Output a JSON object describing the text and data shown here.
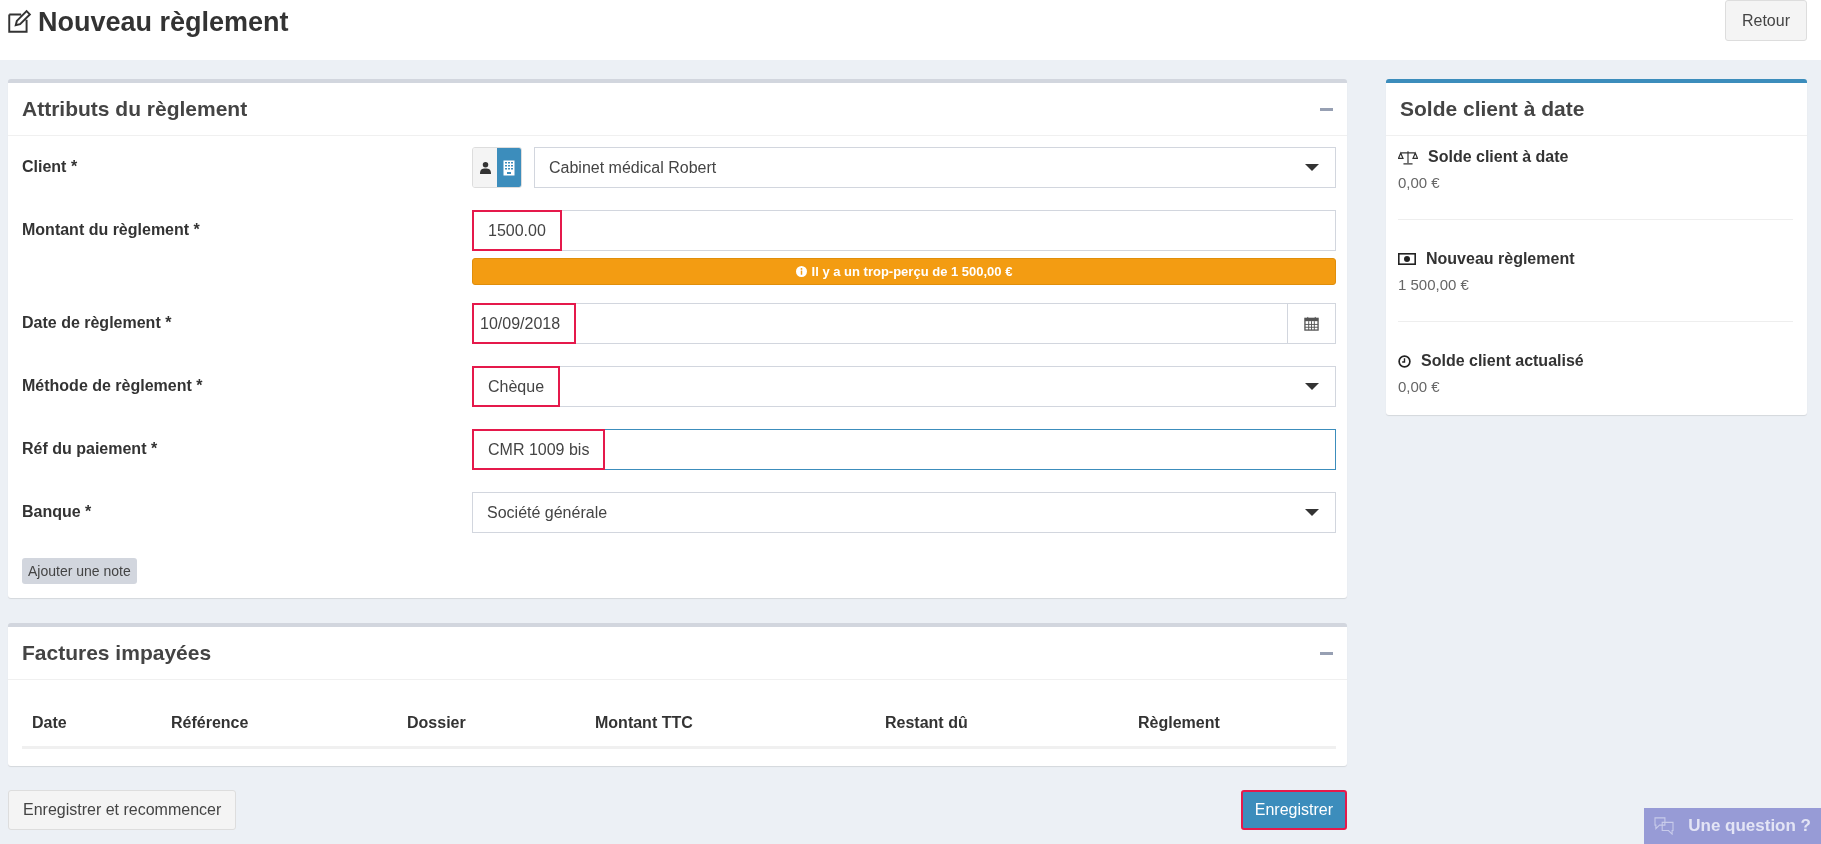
{
  "page": {
    "title": "Nouveau règlement",
    "back_button": "Retour"
  },
  "form_card": {
    "title": "Attributs du règlement",
    "fields": [
      {
        "kind": "client",
        "label": "Client *",
        "value": "Cabinet médical Robert",
        "highlighted": false,
        "focused": false,
        "client_types": [
          {
            "kind": "person",
            "selected": false
          },
          {
            "kind": "company",
            "selected": true
          }
        ]
      },
      {
        "kind": "text",
        "label": "Montant du règlement *",
        "value": "1500.00",
        "highlighted": true,
        "focused": false,
        "alert": "Il y a un trop-perçu de 1 500,00 €"
      },
      {
        "kind": "date",
        "label": "Date de règlement *",
        "value": "10/09/2018",
        "highlighted": true,
        "focused": false
      },
      {
        "kind": "select",
        "label": "Méthode de règlement *",
        "value": "Chèque",
        "highlighted": true,
        "focused": false
      },
      {
        "kind": "text",
        "label": "Réf du paiement *",
        "value": "CMR 1009 bis",
        "highlighted": true,
        "focused": true
      },
      {
        "kind": "select",
        "label": "Banque *",
        "value": "Société générale",
        "highlighted": false,
        "focused": false
      }
    ],
    "note_button": "Ajouter une note"
  },
  "invoices_card": {
    "title": "Factures impayées",
    "columns": [
      "Date",
      "Référence",
      "Dossier",
      "Montant TTC",
      "Restant dû",
      "Règlement"
    ]
  },
  "actions": [
    {
      "label": "Enregistrer et recommencer",
      "kind": "secondary",
      "highlighted": false
    },
    {
      "label": "Enregistrer",
      "kind": "primary",
      "highlighted": true
    }
  ],
  "summary_card": {
    "title": "Solde client à date",
    "items": [
      {
        "kind": "balance",
        "label": "Solde client à date",
        "value": "0,00 €"
      },
      {
        "kind": "money",
        "label": "Nouveau règlement",
        "value": "1 500,00 €"
      },
      {
        "kind": "clock",
        "label": "Solde client actualisé",
        "value": "0,00 €"
      }
    ]
  },
  "help_button": "Une question ?"
}
